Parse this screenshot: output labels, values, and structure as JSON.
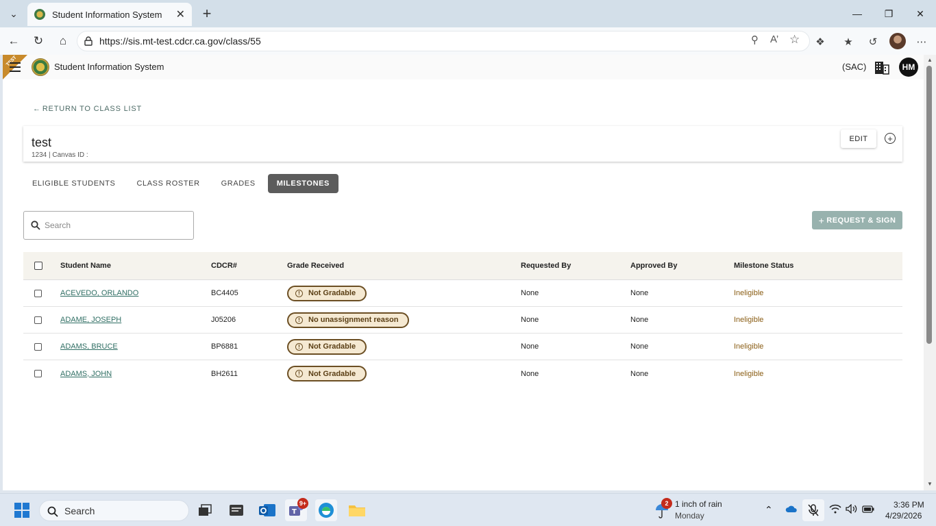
{
  "browser": {
    "tab_title": "Student Information System",
    "url": "https://sis.mt-test.cdcr.ca.gov/class/55"
  },
  "app": {
    "ribbon": "TEST",
    "title": "Student Information System",
    "location": "(SAC)",
    "user_initials": "HM"
  },
  "page": {
    "back_label": "RETURN TO CLASS LIST",
    "class_name": "test",
    "class_sub": "1234 | Canvas ID :",
    "edit_label": "EDIT",
    "tabs": [
      {
        "label": "ELIGIBLE STUDENTS",
        "active": false
      },
      {
        "label": "CLASS ROSTER",
        "active": false
      },
      {
        "label": "GRADES",
        "active": false
      },
      {
        "label": "MILESTONES",
        "active": true
      }
    ],
    "search_placeholder": "Search",
    "request_sign_label": "REQUEST & SIGN"
  },
  "table": {
    "headers": [
      "Student Name",
      "CDCR#",
      "Grade Received",
      "Requested By",
      "Approved By",
      "Milestone Status"
    ],
    "rows": [
      {
        "name": "ACEVEDO, ORLANDO",
        "cdcr": "BC4405",
        "grade": "Not Gradable",
        "requested": "None",
        "approved": "None",
        "status": "Ineligible"
      },
      {
        "name": "ADAME, JOSEPH",
        "cdcr": "J05206",
        "grade": "No unassignment reason",
        "requested": "None",
        "approved": "None",
        "status": "Ineligible"
      },
      {
        "name": "ADAMS, BRUCE",
        "cdcr": "BP6881",
        "grade": "Not Gradable",
        "requested": "None",
        "approved": "None",
        "status": "Ineligible"
      },
      {
        "name": "ADAMS, JOHN",
        "cdcr": "BH2611",
        "grade": "Not Gradable",
        "requested": "None",
        "approved": "None",
        "status": "Ineligible"
      }
    ]
  },
  "taskbar": {
    "search_label": "Search",
    "teams_badge": "9+",
    "weather_badge": "2",
    "weather_line1": "1 inch of rain",
    "weather_line2": "Monday",
    "time": "3:36 PM",
    "date": "4/29/2026"
  },
  "colors": {
    "accent_teal": "#2f6e63",
    "badge_border": "#6b4e23",
    "status_text": "#8a5d14",
    "active_tab": "#5c5c5c",
    "request_button": "#98b2ae"
  }
}
